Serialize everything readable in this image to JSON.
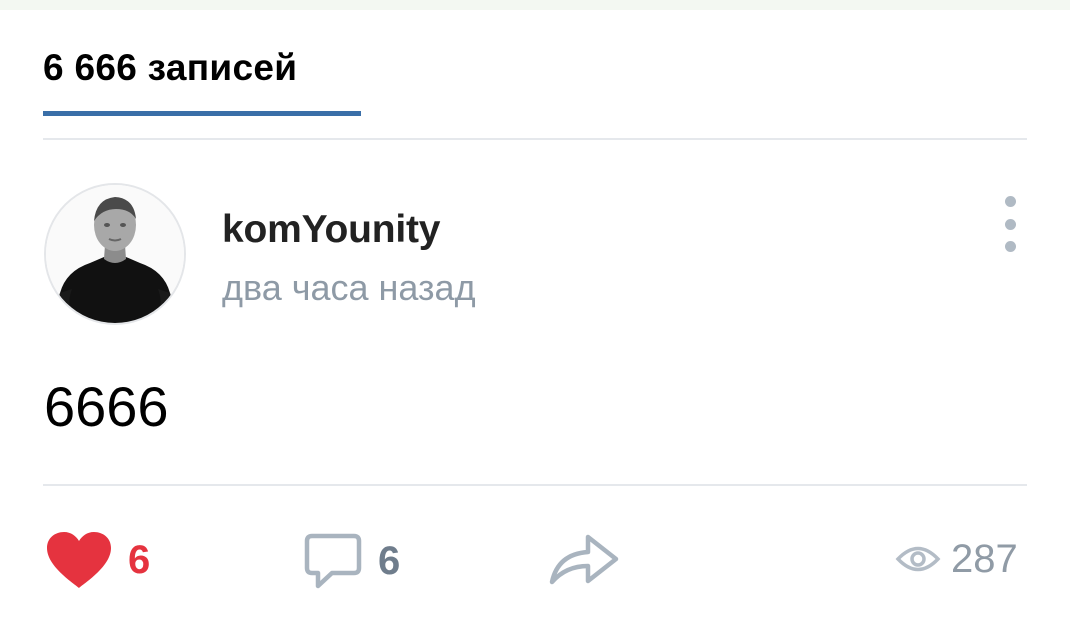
{
  "header": {
    "tab_label": "6 666 записей"
  },
  "post": {
    "author": "komYounity",
    "time": "два часа назад",
    "text": "6666",
    "avatar_icon": "person-photo-avatar",
    "more_icon": "more-vertical-icon"
  },
  "actions": {
    "likes": "6",
    "comments": "6",
    "views": "287",
    "like_icon": "heart-icon",
    "comment_icon": "comment-icon",
    "share_icon": "share-arrow-icon",
    "views_icon": "eye-icon"
  },
  "colors": {
    "accent": "#3a6fa8",
    "like": "#e5333f",
    "muted": "#8e9aa6",
    "icon_gray": "#b0bac4"
  }
}
